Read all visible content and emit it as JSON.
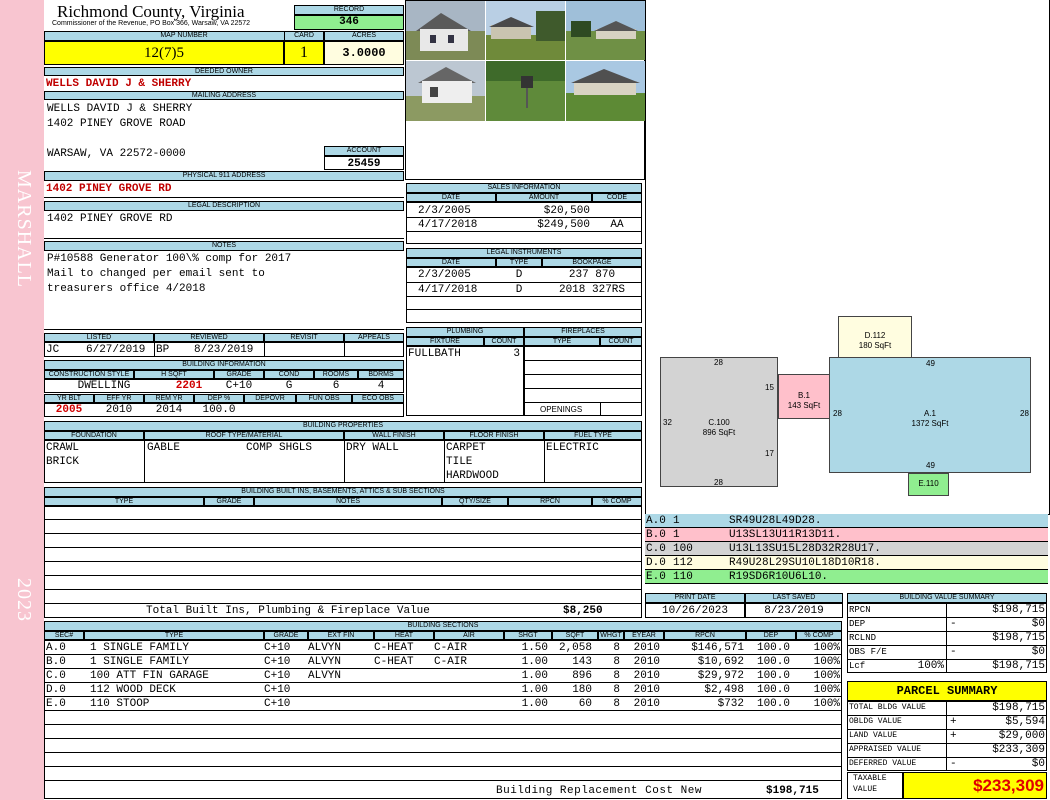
{
  "sidebar": {
    "district": "MARSHALL",
    "year": "2023"
  },
  "header": {
    "county": "Richmond County, Virginia",
    "commissioner": "Commissioner of the Revenue, PO Box 366, Warsaw, VA 22572"
  },
  "record": {
    "label": "RECORD",
    "value": "346"
  },
  "map": {
    "label": "MAP NUMBER",
    "value": "12(7)5"
  },
  "card": {
    "label": "CARD",
    "value": "1"
  },
  "acres": {
    "label": "ACRES",
    "value": "3.0000"
  },
  "owner": {
    "label": "DEEDED OWNER",
    "value": "WELLS DAVID J & SHERRY"
  },
  "mailing": {
    "label": "MAILING ADDRESS",
    "line1": "WELLS DAVID J & SHERRY",
    "line2": "1402 PINEY GROVE ROAD",
    "line3": "WARSAW, VA 22572-0000"
  },
  "account": {
    "label": "ACCOUNT",
    "value": "25459"
  },
  "physical": {
    "label": "PHYSICAL 911 ADDRESS",
    "value": "1402 PINEY GROVE RD"
  },
  "legal": {
    "label": "LEGAL DESCRIPTION",
    "value": "1402 PINEY GROVE RD"
  },
  "notes": {
    "label": "NOTES",
    "lines": [
      "P#10588 Generator 100\\% comp for 2017",
      "Mail to changed per email sent to",
      "treasurers office 4/2018"
    ]
  },
  "review": {
    "listed_label": "LISTED",
    "reviewed_label": "REVIEWED",
    "revisit_label": "REVISIT",
    "appeals_label": "APPEALS",
    "listed_by": "JC",
    "listed_date": "6/27/2019",
    "reviewed_by": "BP",
    "reviewed_date": "8/23/2019"
  },
  "building_info": {
    "label": "BUILDING INFORMATION",
    "headers": [
      "CONSTRUCTION STYLE",
      "H SQFT",
      "GRADE",
      "COND",
      "ROOMS",
      "BDRMS"
    ],
    "values": [
      "DWELLING",
      "2201",
      "C+10",
      "G",
      "6",
      "4"
    ],
    "headers2": [
      "YR BLT",
      "EFF YR",
      "REM YR",
      "DEP %",
      "DEPOVR",
      "FUN OBS",
      "ECO OBS"
    ],
    "values2": [
      "2005",
      "2010",
      "2014",
      "100.0",
      "",
      "",
      ""
    ]
  },
  "sales": {
    "label": "SALES INFORMATION",
    "headers": [
      "DATE",
      "AMOUNT",
      "CODE"
    ],
    "rows": [
      [
        "2/3/2005",
        "$20,500",
        ""
      ],
      [
        "4/17/2018",
        "$249,500",
        "AA"
      ]
    ]
  },
  "legal_instruments": {
    "label": "LEGAL INSTRUMENTS",
    "headers": [
      "DATE",
      "TYPE",
      "BOOKPAGE"
    ],
    "rows": [
      [
        "2/3/2005",
        "D",
        "237 870"
      ],
      [
        "4/17/2018",
        "D",
        "2018 327RS"
      ]
    ]
  },
  "plumbing": {
    "label": "PLUMBING",
    "headers": [
      "FIXTURE",
      "COUNT"
    ],
    "rows": [
      [
        "FULLBATH",
        "3"
      ]
    ]
  },
  "fireplaces": {
    "label": "FIREPLACES",
    "headers": [
      "TYPE",
      "COUNT"
    ],
    "openings": "OPENINGS"
  },
  "properties": {
    "label": "BUILDING PROPERTIES",
    "headers": [
      "FOUNDATION",
      "ROOF TYPE/MATERIAL",
      "WALL FINISH",
      "FLOOR FINISH",
      "FUEL TYPE"
    ],
    "foundation": [
      "CRAWL",
      "BRICK"
    ],
    "roof_type": "GABLE",
    "roof_material": "COMP SHGLS",
    "wall": "DRY WALL",
    "floor": [
      "CARPET",
      "TILE",
      "HARDWOOD"
    ],
    "fuel": "ELECTRIC"
  },
  "builtins": {
    "label": "BUILDING BUILT INS, BASEMENTS, ATTICS & SUB SECTIONS",
    "headers": [
      "TYPE",
      "GRADE",
      "NOTES",
      "QTY/SIZE",
      "RPCN",
      "% COMP"
    ],
    "total_label": "Total Built Ins, Plumbing & Fireplace Value",
    "total_value": "$8,250"
  },
  "sketch": {
    "segments": [
      {
        "name": "D.112",
        "area": "180 SqFt"
      },
      {
        "name": "B.1",
        "area": "143 SqFt"
      },
      {
        "name": "C.100",
        "area": "896 SqFt"
      },
      {
        "name": "A.1",
        "area": "1372 SqFt"
      },
      {
        "name": "E.110",
        "area": ""
      }
    ],
    "dims": {
      "c_top": "28",
      "c_left": "32",
      "c_right_top": "15",
      "c_right_bottom": "17",
      "c_bottom": "28",
      "a_top": "49",
      "a_left": "28",
      "a_right": "28",
      "a_bottom": "49"
    }
  },
  "sketch_codes": [
    {
      "id": "A.0",
      "n": "1",
      "code": "SR49U28L49D28.",
      "color": "#add8e6"
    },
    {
      "id": "B.0",
      "n": "1",
      "code": "U13SL13U11R13D11.",
      "color": "#ffc0cb"
    },
    {
      "id": "C.0",
      "n": "100",
      "code": "U13L13SU15L28D32R28U17.",
      "color": "#d3d3d3"
    },
    {
      "id": "D.0",
      "n": "112",
      "code": "R49U28L29SU10L18D10R18.",
      "color": "#fffde0"
    },
    {
      "id": "E.0",
      "n": "110",
      "code": "R19SD6R10U6L10.",
      "color": "#90ee90"
    }
  ],
  "print": {
    "print_label": "PRINT DATE",
    "print_date": "10/26/2023",
    "saved_label": "LAST SAVED",
    "saved_date": "8/23/2019"
  },
  "value_summary": {
    "label": "BUILDING VALUE SUMMARY",
    "rows": [
      {
        "k": "RPCN",
        "s": "",
        "v": "$198,715"
      },
      {
        "k": "DEP",
        "s": "-",
        "v": "$0"
      },
      {
        "k": "RCLND",
        "s": "",
        "v": "$198,715"
      },
      {
        "k": "OBS F/E",
        "s": "-",
        "v": "$0"
      },
      {
        "k": "Lcf",
        "s": "100%",
        "v": "$198,715"
      }
    ]
  },
  "parcel": {
    "label": "PARCEL SUMMARY",
    "rows": [
      {
        "k": "TOTAL BLDG VALUE",
        "s": "",
        "v": "$198,715"
      },
      {
        "k": "OBLDG VALUE",
        "s": "+",
        "v": "$5,594"
      },
      {
        "k": "LAND VALUE",
        "s": "+",
        "v": "$29,000"
      },
      {
        "k": "APPRAISED VALUE",
        "s": "",
        "v": "$233,309"
      },
      {
        "k": "DEFERRED VALUE",
        "s": "-",
        "v": "$0"
      }
    ],
    "taxable_label_1": "TAXABLE",
    "taxable_label_2": "VALUE",
    "taxable_value": "$233,309"
  },
  "sections": {
    "label": "BUILDING SECTIONS",
    "headers": [
      "SEC#",
      "TYPE",
      "GRADE",
      "EXT FIN",
      "HEAT",
      "AIR",
      "SHGT",
      "SQFT",
      "WHGT",
      "EYEAR",
      "RPCN",
      "DEP",
      "% COMP"
    ],
    "rows": [
      [
        "A.0",
        "1 SINGLE FAMILY",
        "C+10",
        "ALVYN",
        "C-HEAT",
        "C-AIR",
        "1.50",
        "2,058",
        "8",
        "2010",
        "$146,571",
        "100.0",
        "100%"
      ],
      [
        "B.0",
        "1 SINGLE FAMILY",
        "C+10",
        "ALVYN",
        "C-HEAT",
        "C-AIR",
        "1.00",
        "143",
        "8",
        "2010",
        "$10,692",
        "100.0",
        "100%"
      ],
      [
        "C.0",
        "100 ATT FIN GARAGE",
        "C+10",
        "ALVYN",
        "",
        "",
        "1.00",
        "896",
        "8",
        "2010",
        "$29,972",
        "100.0",
        "100%"
      ],
      [
        "D.0",
        "112 WOOD DECK",
        "C+10",
        "",
        "",
        "",
        "1.00",
        "180",
        "8",
        "2010",
        "$2,498",
        "100.0",
        "100%"
      ],
      [
        "E.0",
        "110 STOOP",
        "C+10",
        "",
        "",
        "",
        "1.00",
        "60",
        "8",
        "2010",
        "$732",
        "100.0",
        "100%"
      ]
    ],
    "total_label": "Building Replacement Cost New",
    "total_value": "$198,715"
  }
}
